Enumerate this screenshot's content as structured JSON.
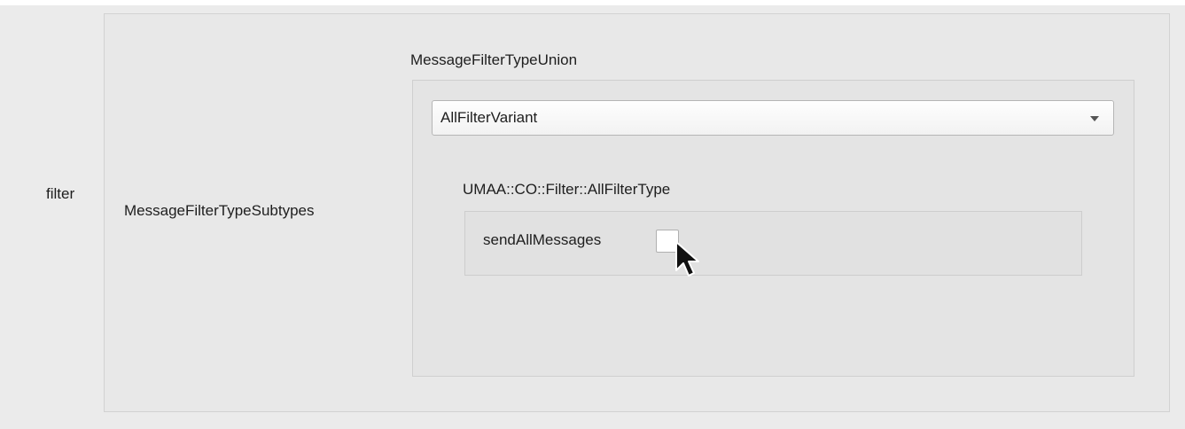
{
  "form": {
    "field_label": "filter",
    "subtypes_label": "MessageFilterTypeSubtypes",
    "union": {
      "title": "MessageFilterTypeUnion",
      "selected_variant": "AllFilterVariant",
      "variant_type": {
        "title": "UMAA::CO::Filter::AllFilterType",
        "fields": [
          {
            "label": "sendAllMessages",
            "checked": false
          }
        ]
      }
    }
  },
  "icons": {
    "dropdown": "chevron-down-icon",
    "pointer": "mouse-pointer-icon"
  }
}
